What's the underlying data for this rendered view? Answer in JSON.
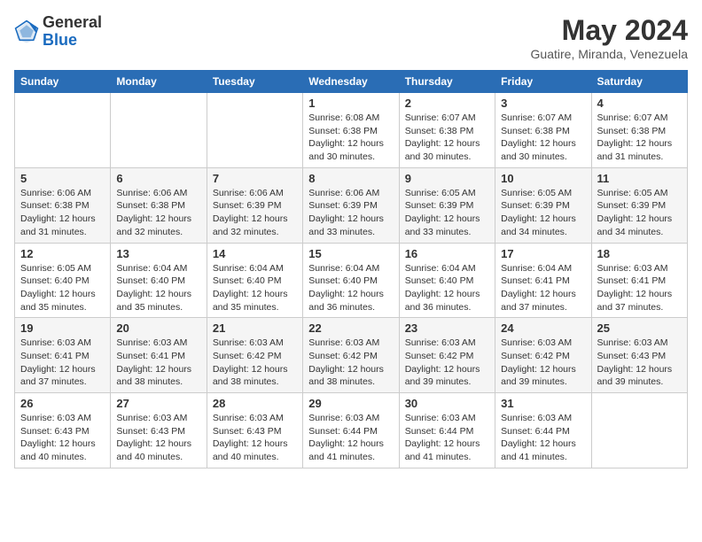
{
  "logo": {
    "general": "General",
    "blue": "Blue"
  },
  "header": {
    "month_year": "May 2024",
    "location": "Guatire, Miranda, Venezuela"
  },
  "weekdays": [
    "Sunday",
    "Monday",
    "Tuesday",
    "Wednesday",
    "Thursday",
    "Friday",
    "Saturday"
  ],
  "weeks": [
    [
      {
        "day": "",
        "info": ""
      },
      {
        "day": "",
        "info": ""
      },
      {
        "day": "",
        "info": ""
      },
      {
        "day": "1",
        "info": "Sunrise: 6:08 AM\nSunset: 6:38 PM\nDaylight: 12 hours\nand 30 minutes."
      },
      {
        "day": "2",
        "info": "Sunrise: 6:07 AM\nSunset: 6:38 PM\nDaylight: 12 hours\nand 30 minutes."
      },
      {
        "day": "3",
        "info": "Sunrise: 6:07 AM\nSunset: 6:38 PM\nDaylight: 12 hours\nand 30 minutes."
      },
      {
        "day": "4",
        "info": "Sunrise: 6:07 AM\nSunset: 6:38 PM\nDaylight: 12 hours\nand 31 minutes."
      }
    ],
    [
      {
        "day": "5",
        "info": "Sunrise: 6:06 AM\nSunset: 6:38 PM\nDaylight: 12 hours\nand 31 minutes."
      },
      {
        "day": "6",
        "info": "Sunrise: 6:06 AM\nSunset: 6:38 PM\nDaylight: 12 hours\nand 32 minutes."
      },
      {
        "day": "7",
        "info": "Sunrise: 6:06 AM\nSunset: 6:39 PM\nDaylight: 12 hours\nand 32 minutes."
      },
      {
        "day": "8",
        "info": "Sunrise: 6:06 AM\nSunset: 6:39 PM\nDaylight: 12 hours\nand 33 minutes."
      },
      {
        "day": "9",
        "info": "Sunrise: 6:05 AM\nSunset: 6:39 PM\nDaylight: 12 hours\nand 33 minutes."
      },
      {
        "day": "10",
        "info": "Sunrise: 6:05 AM\nSunset: 6:39 PM\nDaylight: 12 hours\nand 34 minutes."
      },
      {
        "day": "11",
        "info": "Sunrise: 6:05 AM\nSunset: 6:39 PM\nDaylight: 12 hours\nand 34 minutes."
      }
    ],
    [
      {
        "day": "12",
        "info": "Sunrise: 6:05 AM\nSunset: 6:40 PM\nDaylight: 12 hours\nand 35 minutes."
      },
      {
        "day": "13",
        "info": "Sunrise: 6:04 AM\nSunset: 6:40 PM\nDaylight: 12 hours\nand 35 minutes."
      },
      {
        "day": "14",
        "info": "Sunrise: 6:04 AM\nSunset: 6:40 PM\nDaylight: 12 hours\nand 35 minutes."
      },
      {
        "day": "15",
        "info": "Sunrise: 6:04 AM\nSunset: 6:40 PM\nDaylight: 12 hours\nand 36 minutes."
      },
      {
        "day": "16",
        "info": "Sunrise: 6:04 AM\nSunset: 6:40 PM\nDaylight: 12 hours\nand 36 minutes."
      },
      {
        "day": "17",
        "info": "Sunrise: 6:04 AM\nSunset: 6:41 PM\nDaylight: 12 hours\nand 37 minutes."
      },
      {
        "day": "18",
        "info": "Sunrise: 6:03 AM\nSunset: 6:41 PM\nDaylight: 12 hours\nand 37 minutes."
      }
    ],
    [
      {
        "day": "19",
        "info": "Sunrise: 6:03 AM\nSunset: 6:41 PM\nDaylight: 12 hours\nand 37 minutes."
      },
      {
        "day": "20",
        "info": "Sunrise: 6:03 AM\nSunset: 6:41 PM\nDaylight: 12 hours\nand 38 minutes."
      },
      {
        "day": "21",
        "info": "Sunrise: 6:03 AM\nSunset: 6:42 PM\nDaylight: 12 hours\nand 38 minutes."
      },
      {
        "day": "22",
        "info": "Sunrise: 6:03 AM\nSunset: 6:42 PM\nDaylight: 12 hours\nand 38 minutes."
      },
      {
        "day": "23",
        "info": "Sunrise: 6:03 AM\nSunset: 6:42 PM\nDaylight: 12 hours\nand 39 minutes."
      },
      {
        "day": "24",
        "info": "Sunrise: 6:03 AM\nSunset: 6:42 PM\nDaylight: 12 hours\nand 39 minutes."
      },
      {
        "day": "25",
        "info": "Sunrise: 6:03 AM\nSunset: 6:43 PM\nDaylight: 12 hours\nand 39 minutes."
      }
    ],
    [
      {
        "day": "26",
        "info": "Sunrise: 6:03 AM\nSunset: 6:43 PM\nDaylight: 12 hours\nand 40 minutes."
      },
      {
        "day": "27",
        "info": "Sunrise: 6:03 AM\nSunset: 6:43 PM\nDaylight: 12 hours\nand 40 minutes."
      },
      {
        "day": "28",
        "info": "Sunrise: 6:03 AM\nSunset: 6:43 PM\nDaylight: 12 hours\nand 40 minutes."
      },
      {
        "day": "29",
        "info": "Sunrise: 6:03 AM\nSunset: 6:44 PM\nDaylight: 12 hours\nand 41 minutes."
      },
      {
        "day": "30",
        "info": "Sunrise: 6:03 AM\nSunset: 6:44 PM\nDaylight: 12 hours\nand 41 minutes."
      },
      {
        "day": "31",
        "info": "Sunrise: 6:03 AM\nSunset: 6:44 PM\nDaylight: 12 hours\nand 41 minutes."
      },
      {
        "day": "",
        "info": ""
      }
    ]
  ]
}
